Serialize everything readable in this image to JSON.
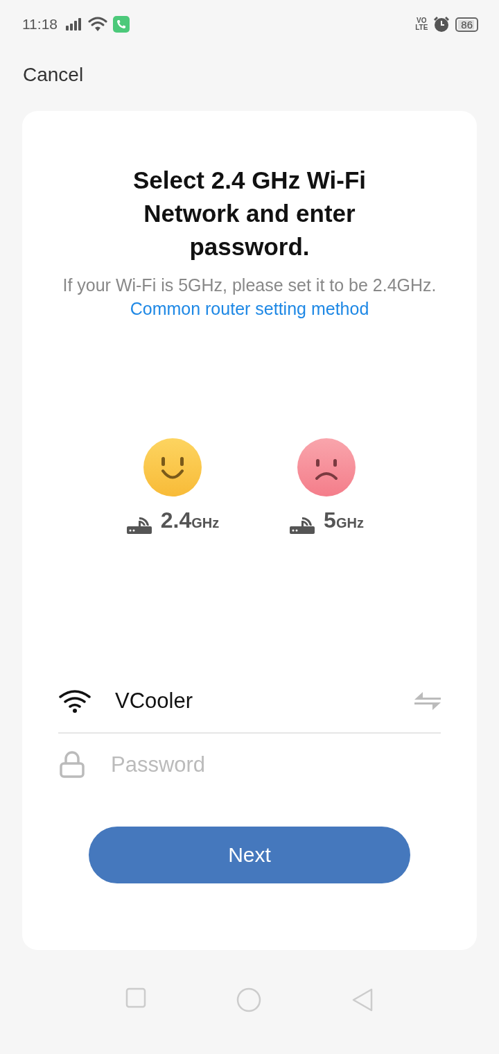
{
  "status_bar": {
    "time": "11:18",
    "volte_top": "VO",
    "volte_bottom": "LTE",
    "battery": "86"
  },
  "cancel": "Cancel",
  "title": "Select 2.4 GHz Wi-Fi Network and enter password.",
  "hint": "If your Wi-Fi is 5GHz, please set it to be 2.4GHz.",
  "hint_link": "Common router setting method",
  "bands": [
    {
      "kind": "good",
      "value": "2.4",
      "unit": "GHz"
    },
    {
      "kind": "bad",
      "value": "5",
      "unit": "GHz"
    }
  ],
  "network": {
    "value": "VCooler"
  },
  "password": {
    "placeholder": "Password"
  },
  "next_button": "Next"
}
